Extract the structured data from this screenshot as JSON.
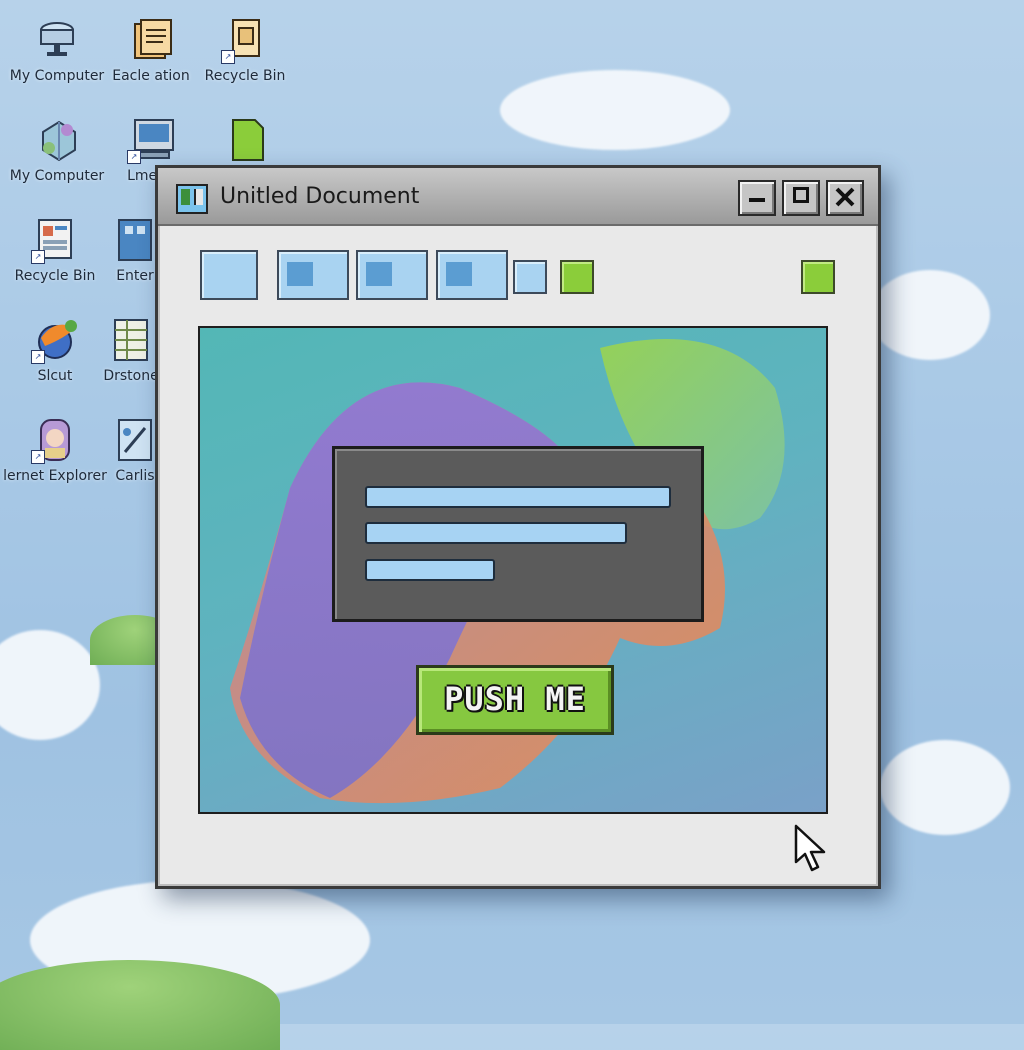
{
  "window": {
    "title": "Unitled Document",
    "button": "PUSH ME"
  },
  "desktop": {
    "icons": [
      {
        "label": "My Computer",
        "icon": "computer-icon"
      },
      {
        "label": "Eacle ation",
        "icon": "folder-icon"
      },
      {
        "label": "Recycle Bin",
        "icon": "recycle-bin-icon"
      },
      {
        "label": "My Computer",
        "icon": "network-icon"
      },
      {
        "label": "Lmenu",
        "icon": "screen-icon"
      },
      {
        "label": "Recycle Bin",
        "icon": "document-icon"
      },
      {
        "label": "Enter",
        "icon": "app-icon"
      },
      {
        "label": "Slcut",
        "icon": "browser-icon"
      },
      {
        "label": "Drstone",
        "icon": "spreadsheet-icon"
      },
      {
        "label": "lernet Explorer",
        "icon": "user-icon"
      },
      {
        "label": "Carlis",
        "icon": "tool-icon"
      }
    ]
  },
  "colors": {
    "accent_green": "#86c840",
    "tool_blue": "#a9d3f1",
    "dialog_gray": "#5b5b5b"
  }
}
